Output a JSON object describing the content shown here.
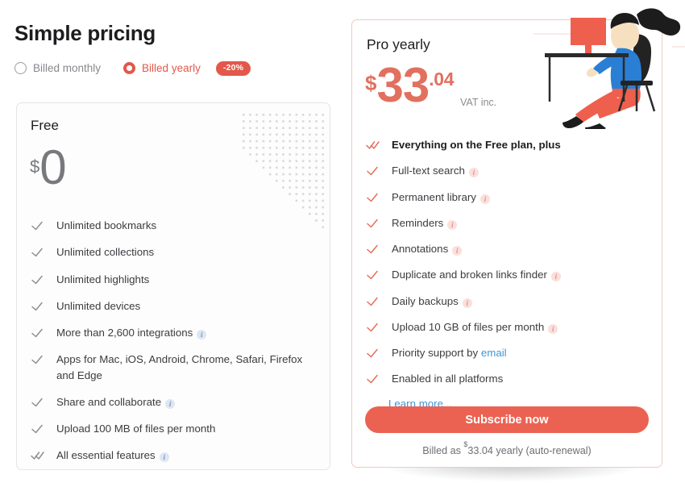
{
  "header": {
    "title": "Simple pricing",
    "billing_options": [
      {
        "label": "Billed monthly",
        "selected": false
      },
      {
        "label": "Billed yearly",
        "selected": true
      }
    ],
    "discount_badge": "-20%"
  },
  "colors": {
    "accent_red": "#ec6252",
    "price_red": "#e2705f",
    "link_blue": "#3f96d6",
    "free_gray": "#77797d",
    "card_border_gray": "#e4e5e7",
    "card_border_red": "#f0c9c3"
  },
  "free_plan": {
    "name": "Free",
    "currency": "$",
    "amount": "0",
    "features": [
      {
        "text": "Unlimited bookmarks",
        "info": false,
        "double_check": false
      },
      {
        "text": "Unlimited collections",
        "info": false,
        "double_check": false
      },
      {
        "text": "Unlimited highlights",
        "info": false,
        "double_check": false
      },
      {
        "text": "Unlimited devices",
        "info": false,
        "double_check": false
      },
      {
        "text": "More than 2,600 integrations",
        "info": true,
        "double_check": false
      },
      {
        "text": "Apps for Mac, iOS, Android, Chrome, Safari, Firefox and Edge",
        "info": false,
        "double_check": false
      },
      {
        "text": "Share and collaborate",
        "info": true,
        "double_check": false
      },
      {
        "text": "Upload 100 MB of files per month",
        "info": false,
        "double_check": false
      },
      {
        "text": "All essential features",
        "info": true,
        "double_check": true
      }
    ]
  },
  "pro_plan": {
    "name": "Pro yearly",
    "currency": "$",
    "amount": "33",
    "cents": ".04",
    "vat_note": "VAT inc.",
    "features": [
      {
        "text": "Everything on the Free plan, plus",
        "info": false,
        "double_check": true,
        "bold": true
      },
      {
        "text": "Full-text search",
        "info": true,
        "double_check": false
      },
      {
        "text": "Permanent library",
        "info": true,
        "double_check": false
      },
      {
        "text": "Reminders",
        "info": true,
        "double_check": false
      },
      {
        "text": "Annotations",
        "info": true,
        "double_check": false
      },
      {
        "text": "Duplicate and broken links finder",
        "info": true,
        "double_check": false
      },
      {
        "text": "Daily backups",
        "info": true,
        "double_check": false
      },
      {
        "text": "Upload 10 GB of files per month",
        "info": true,
        "double_check": false
      },
      {
        "text": "Priority support by ",
        "link_text": "email",
        "info": false,
        "double_check": false
      },
      {
        "text": "Enabled in all platforms",
        "info": false,
        "double_check": false
      }
    ],
    "learn_more": "Learn more...",
    "subscribe_label": "Subscribe now",
    "billed_note_prefix": "Billed as ",
    "billed_note_currency": "$",
    "billed_note_suffix": "33.04 yearly (auto-renewal)"
  },
  "illustration": {
    "name": "person-working-at-desk-illustration"
  }
}
